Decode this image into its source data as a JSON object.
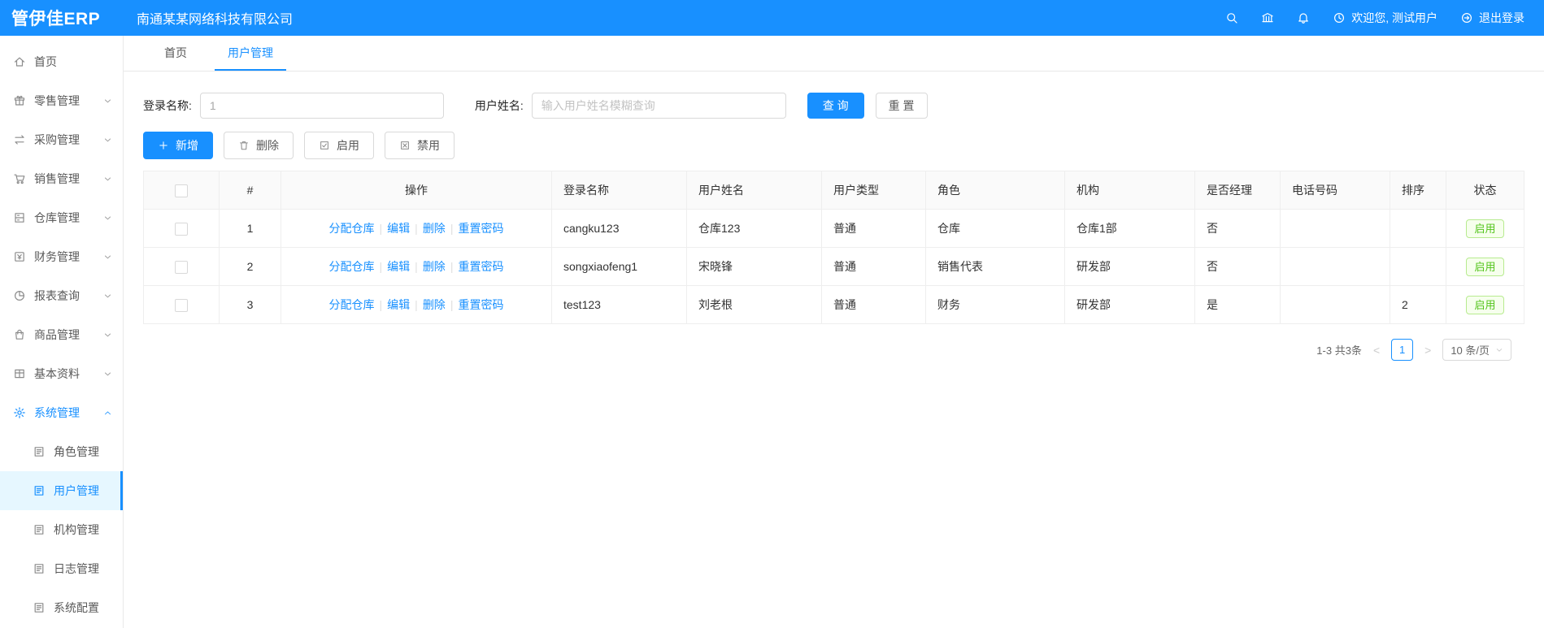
{
  "header": {
    "logo": "管伊佳ERP",
    "company": "南通某某网络科技有限公司",
    "welcome": "欢迎您, 测试用户",
    "logout": "退出登录"
  },
  "sidebar": {
    "items": [
      {
        "label": "首页",
        "icon": "home"
      },
      {
        "label": "零售管理",
        "icon": "retail",
        "expand": "down"
      },
      {
        "label": "采购管理",
        "icon": "purchase",
        "expand": "down"
      },
      {
        "label": "销售管理",
        "icon": "sales",
        "expand": "down"
      },
      {
        "label": "仓库管理",
        "icon": "warehouse",
        "expand": "down"
      },
      {
        "label": "财务管理",
        "icon": "finance",
        "expand": "down"
      },
      {
        "label": "报表查询",
        "icon": "report",
        "expand": "down"
      },
      {
        "label": "商品管理",
        "icon": "product",
        "expand": "down"
      },
      {
        "label": "基本资料",
        "icon": "basedata",
        "expand": "down"
      },
      {
        "label": "系统管理",
        "icon": "system",
        "expand": "up",
        "active_parent": true,
        "children": [
          {
            "label": "角色管理",
            "icon": "doc"
          },
          {
            "label": "用户管理",
            "icon": "doc",
            "active": true
          },
          {
            "label": "机构管理",
            "icon": "doc"
          },
          {
            "label": "日志管理",
            "icon": "doc"
          },
          {
            "label": "系统配置",
            "icon": "doc"
          }
        ]
      }
    ]
  },
  "tabs": [
    {
      "label": "首页",
      "active": false
    },
    {
      "label": "用户管理",
      "active": true
    }
  ],
  "search": {
    "login_label": "登录名称:",
    "login_value": "1",
    "name_label": "用户姓名:",
    "name_placeholder": "输入用户姓名模糊查询",
    "query": "查 询",
    "reset": "重 置"
  },
  "toolbar": {
    "add": "新增",
    "delete": "删除",
    "enable": "启用",
    "disable": "禁用"
  },
  "table": {
    "headers": [
      "#",
      "操作",
      "登录名称",
      "用户姓名",
      "用户类型",
      "角色",
      "机构",
      "是否经理",
      "电话号码",
      "排序",
      "状态"
    ],
    "op_links": [
      "分配仓库",
      "编辑",
      "删除",
      "重置密码"
    ],
    "rows": [
      {
        "index": "1",
        "login": "cangku123",
        "name": "仓库123",
        "type": "普通",
        "role": "仓库",
        "org": "仓库1部",
        "manager": "否",
        "phone": "",
        "sort": "",
        "status": "启用"
      },
      {
        "index": "2",
        "login": "songxiaofeng1",
        "name": "宋晓锋",
        "type": "普通",
        "role": "销售代表",
        "org": "研发部",
        "manager": "否",
        "phone": "",
        "sort": "",
        "status": "启用"
      },
      {
        "index": "3",
        "login": "test123",
        "name": "刘老根",
        "type": "普通",
        "role": "财务",
        "org": "研发部",
        "manager": "是",
        "phone": "",
        "sort": "2",
        "status": "启用"
      }
    ]
  },
  "pagination": {
    "total": "1-3 共3条",
    "prev": "<",
    "page": "1",
    "next": ">",
    "per_page": "10 条/页"
  }
}
